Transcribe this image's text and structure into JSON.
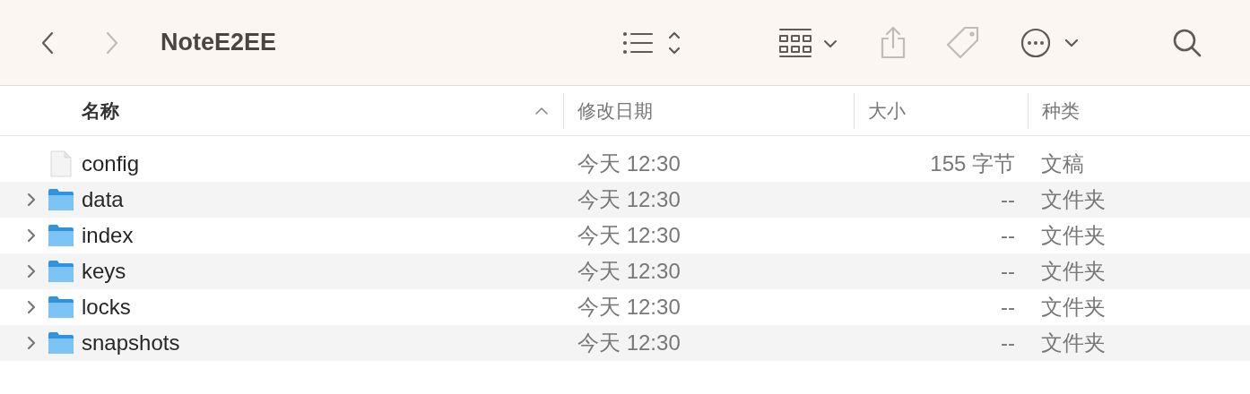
{
  "window": {
    "title": "NoteE2EE"
  },
  "toolbar": [
    {
      "kind": "back",
      "disabled": false
    },
    {
      "kind": "forward",
      "disabled": true
    },
    {
      "kind": "list-view",
      "disabled": false
    },
    {
      "kind": "group",
      "disabled": false
    },
    {
      "kind": "share",
      "disabled": true
    },
    {
      "kind": "tag",
      "disabled": true
    },
    {
      "kind": "more",
      "disabled": false
    },
    {
      "kind": "search",
      "disabled": false
    }
  ],
  "table": {
    "columns": [
      {
        "label": "名称",
        "sorted": true
      },
      {
        "label": "修改日期",
        "sorted": false
      },
      {
        "label": "大小",
        "sorted": false
      },
      {
        "label": "种类",
        "sorted": false
      }
    ],
    "rows": [
      {
        "kind": "file",
        "name": "config",
        "modified": "今天 12:30",
        "size": "155 字节",
        "type": "文稿"
      },
      {
        "kind": "folder",
        "name": "data",
        "modified": "今天 12:30",
        "size": "--",
        "type": "文件夹"
      },
      {
        "kind": "folder",
        "name": "index",
        "modified": "今天 12:30",
        "size": "--",
        "type": "文件夹"
      },
      {
        "kind": "folder",
        "name": "keys",
        "modified": "今天 12:30",
        "size": "--",
        "type": "文件夹"
      },
      {
        "kind": "folder",
        "name": "locks",
        "modified": "今天 12:30",
        "size": "--",
        "type": "文件夹"
      },
      {
        "kind": "folder",
        "name": "snapshots",
        "modified": "今天 12:30",
        "size": "--",
        "type": "文件夹"
      }
    ]
  }
}
